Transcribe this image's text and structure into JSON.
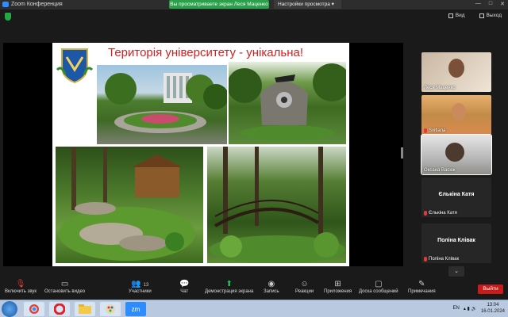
{
  "window": {
    "title": "Zoom Конференция",
    "share_banner": "Вы просматриваете экран Леся Маценко",
    "view_options": "Настройки просмотра",
    "controls": [
      "—",
      "□",
      "✕"
    ]
  },
  "topbar": {
    "view_label": "Вид",
    "exit_label": "Выход"
  },
  "slide": {
    "title": "Територія університету - унікальна!"
  },
  "participants": [
    {
      "name": "Леся Маценко",
      "muted": false
    },
    {
      "name": "Svitlana",
      "muted": true
    },
    {
      "name": "Оксана Васюк",
      "muted": false
    },
    {
      "name": "Єлькіна Катя",
      "display": "Єлькіна Катя",
      "muted": true
    },
    {
      "name": "Поліна Клівак",
      "display": "Поліна Клівак",
      "muted": true
    }
  ],
  "toolbar": {
    "unmute": "Включить звук",
    "start_video": "Остановить видео",
    "participants": "Участники",
    "participants_count": "13",
    "chat": "Чат",
    "share_screen": "Демонстрация экрана",
    "record": "Запись",
    "reactions": "Реакции",
    "apps": "Приложения",
    "whiteboard": "Доска сообщений",
    "notes": "Примечания",
    "end": "Выйти"
  },
  "taskbar": {
    "lang": "EN",
    "time": "13:04",
    "date": "16.01.2024",
    "apps": [
      "chrome",
      "opera",
      "explorer",
      "paint",
      "zoom"
    ],
    "zoom_label": "zm"
  },
  "colors": {
    "share_green": "#2aa04a",
    "end_red": "#c81c1c",
    "slide_title": "#d42020"
  }
}
